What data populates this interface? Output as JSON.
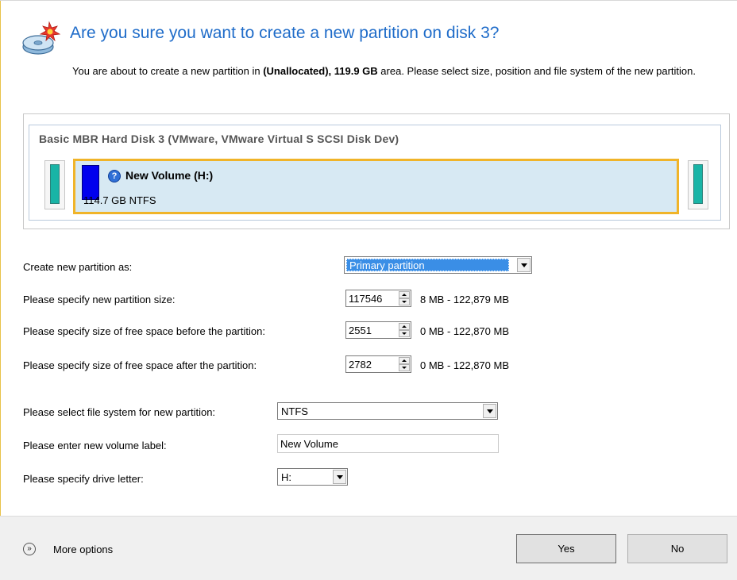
{
  "header": {
    "title": "Are you sure you want to create a new partition on disk 3?",
    "desc_prefix": "You are about to create a new partition in ",
    "desc_bold": "(Unallocated), 119.9 GB",
    "desc_suffix": " area. Please select size, position and file system of the new partition.",
    "icon": "disk-new-partition-icon"
  },
  "disk": {
    "title": "Basic MBR Hard Disk 3 (VMware, VMware Virtual S SCSI Disk Dev)",
    "partition": {
      "name": "New Volume (H:)",
      "size_fs": "114.7 GB NTFS",
      "color": "#0000ee",
      "unallocated_color": "#19b4a6",
      "highlight_color": "#f0b429"
    }
  },
  "form": {
    "create_as": {
      "label": "Create new partition as:",
      "value": "Primary partition"
    },
    "size": {
      "label": "Please specify new partition size:",
      "value": "117546",
      "range": "8 MB - 122,879 MB"
    },
    "before": {
      "label": "Please specify size of free space before the partition:",
      "value": "2551",
      "range": "0 MB - 122,870 MB"
    },
    "after": {
      "label": "Please specify size of free space after the partition:",
      "value": "2782",
      "range": "0 MB - 122,870 MB"
    },
    "filesystem": {
      "label": "Please select file system for new partition:",
      "value": "NTFS"
    },
    "volume_label": {
      "label": "Please enter new volume label:",
      "value": "New Volume"
    },
    "drive_letter": {
      "label": "Please specify drive letter:",
      "value": "H:"
    }
  },
  "footer": {
    "more_options": "More options",
    "yes": "Yes",
    "no": "No"
  },
  "colors": {
    "title": "#1f6cc9",
    "selection": "#3a8ee6"
  }
}
